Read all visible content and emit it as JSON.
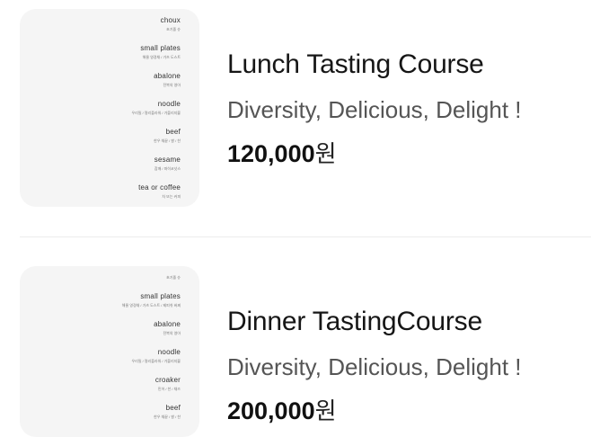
{
  "courses": [
    {
      "title": "Lunch Tasting Course",
      "tagline": "Diversity, Delicious, Delight !",
      "price": "120,000",
      "currency": "원",
      "menu_card": [
        {
          "name": "choux",
          "sub": "초기즐 슈"
        },
        {
          "name": "small plates",
          "sub": "해물 영경채 / 가츠 도스트"
        },
        {
          "name": "abalone",
          "sub": "전복의 영아"
        },
        {
          "name": "noodle",
          "sub": "우리밀 / 명리플라워 / 가볼리지블"
        },
        {
          "name": "beef",
          "sub": "한우 채끝 / 쌀 / 찬"
        },
        {
          "name": "sesame",
          "sub": "참깨 / 파히코넛스"
        },
        {
          "name": "tea or coffee",
          "sub": "차 또는 커피"
        }
      ]
    },
    {
      "title": "Dinner TastingCourse",
      "tagline": "Diversity, Delicious, Delight !",
      "price": "200,000",
      "currency": "원",
      "menu_card": [
        {
          "name": "",
          "sub": "초기즐 슈"
        },
        {
          "name": "small plates",
          "sub": "해물 영경채 / 가츠 도스트 / 제피쉬 버찌"
        },
        {
          "name": "abalone",
          "sub": "전복의 영아"
        },
        {
          "name": "noodle",
          "sub": "우리밀 / 명리플라워 / 가볼리지블"
        },
        {
          "name": "croaker",
          "sub": "민어 / 찬 / 채즈"
        },
        {
          "name": "beef",
          "sub": "한우 채끝 / 쌀 / 찬"
        }
      ]
    }
  ]
}
